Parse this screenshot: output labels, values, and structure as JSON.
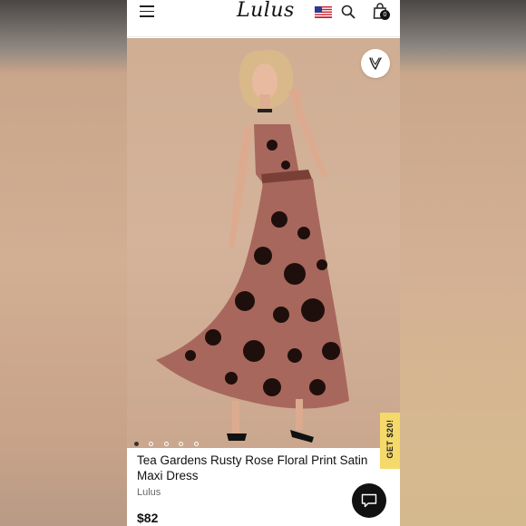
{
  "header": {
    "logo": "Lulus",
    "bag_count": "0",
    "icons": [
      "menu-icon",
      "us-flag-icon",
      "search-icon",
      "shopping-bag-icon"
    ]
  },
  "product": {
    "title_line1": "Tea Gardens Rusty Rose Floral Print Satin",
    "title_line2": "Maxi Dress",
    "brand": "Lulus",
    "price": "$82",
    "image_count": 5,
    "active_image": 1
  },
  "promo": {
    "label": "GET $20!"
  },
  "colors": {
    "accent_yellow": "#f5d96b",
    "dress_rose": "#a8675c",
    "text_dark": "#111111"
  }
}
